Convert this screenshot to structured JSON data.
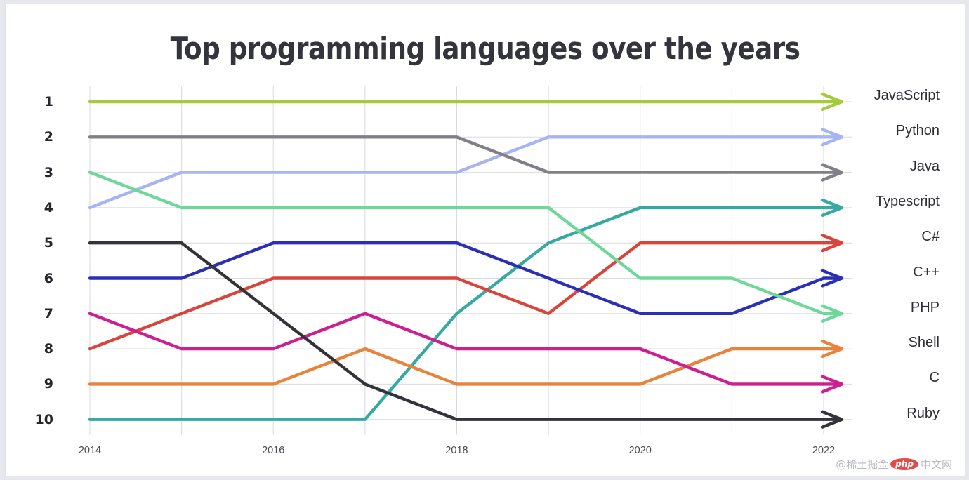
{
  "chart_data": {
    "type": "line",
    "subtype": "bump-chart",
    "title": "Top programming languages over the years",
    "xlabel": "",
    "ylabel": "",
    "x": [
      2014,
      2015,
      2016,
      2017,
      2018,
      2019,
      2020,
      2021,
      2022
    ],
    "x_tick_labels": [
      "2014",
      "2016",
      "2018",
      "2020",
      "2022"
    ],
    "x_tick_values": [
      2014,
      2016,
      2018,
      2020,
      2022
    ],
    "y_tick_labels": [
      "1",
      "2",
      "3",
      "4",
      "5",
      "6",
      "7",
      "8",
      "9",
      "10"
    ],
    "ylim": [
      1,
      10
    ],
    "y_inverted": true,
    "grid": true,
    "legend_position": "right-endpoint-labels",
    "series": [
      {
        "name": "JavaScript",
        "color": "#a7c93c",
        "values": [
          1,
          1,
          1,
          1,
          1,
          1,
          1,
          1,
          1
        ]
      },
      {
        "name": "Python",
        "color": "#a7b4f4",
        "values": [
          4,
          3,
          3,
          3,
          3,
          2,
          2,
          2,
          2
        ]
      },
      {
        "name": "Java",
        "color": "#808088",
        "values": [
          2,
          2,
          2,
          2,
          2,
          3,
          3,
          3,
          3
        ]
      },
      {
        "name": "Typescript",
        "color": "#35aaa3",
        "values": [
          10,
          10,
          10,
          10,
          7,
          5,
          4,
          4,
          4
        ]
      },
      {
        "name": "C#",
        "color": "#d9453c",
        "values": [
          8,
          7,
          6,
          6,
          6,
          7,
          5,
          5,
          5
        ]
      },
      {
        "name": "C++",
        "color": "#2b2fb6",
        "values": [
          6,
          6,
          5,
          5,
          5,
          6,
          7,
          7,
          6
        ]
      },
      {
        "name": "PHP",
        "color": "#6ed89b",
        "values": [
          3,
          4,
          4,
          4,
          4,
          4,
          6,
          6,
          7
        ]
      },
      {
        "name": "Shell",
        "color": "#e8833c",
        "values": [
          9,
          9,
          9,
          8,
          9,
          9,
          9,
          8,
          8
        ]
      },
      {
        "name": "C",
        "color": "#cc1f91",
        "values": [
          7,
          8,
          8,
          7,
          8,
          8,
          8,
          9,
          9
        ]
      },
      {
        "name": "Ruby",
        "color": "#33333a",
        "values": [
          5,
          5,
          7,
          9,
          10,
          10,
          10,
          10,
          10
        ]
      }
    ]
  },
  "axis": {
    "rank_labels": [
      "1",
      "2",
      "3",
      "4",
      "5",
      "6",
      "7",
      "8",
      "9",
      "10"
    ],
    "year_labels": [
      "2014",
      "2016",
      "2018",
      "2020",
      "2022"
    ]
  },
  "legend": {
    "labels": [
      "JavaScript",
      "Python",
      "Java",
      "Typescript",
      "C#",
      "C++",
      "PHP",
      "Shell",
      "C",
      "Ruby"
    ]
  },
  "watermark": {
    "prefix": "@稀土掘金",
    "badge": "php",
    "suffix": "中文网"
  },
  "colors": {
    "background": "#e7e7ee",
    "card": "#ffffff",
    "title": "#34343c",
    "grid": "#d9d9e0",
    "axis_text": "#26262c"
  }
}
